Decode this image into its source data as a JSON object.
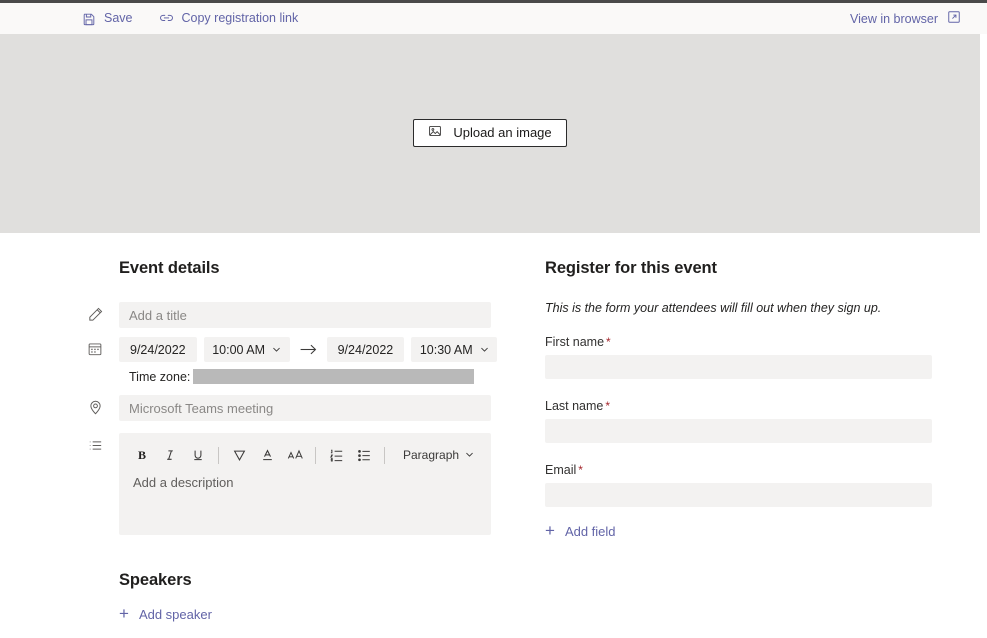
{
  "commandbar": {
    "save_label": "Save",
    "save_icon": "save-floppy-icon",
    "copy_link_label": "Copy registration link",
    "copy_link_icon": "link-icon",
    "view_in_browser_label": "View in browser",
    "view_in_browser_icon": "open-in-new-window-icon"
  },
  "hero": {
    "upload_label": "Upload an image",
    "upload_icon": "image-icon",
    "background_color": "#e0dfdd"
  },
  "event_details": {
    "heading": "Event details",
    "title_placeholder": "Add a title",
    "title_value": "",
    "title_icon": "pencil-icon",
    "schedule_icon": "calendar-icon",
    "start_date": "9/24/2022",
    "start_time": "10:00 AM",
    "arrow": "→",
    "end_date": "9/24/2022",
    "end_time": "10:30 AM",
    "timezone_label": "Time zone:",
    "timezone_value": "",
    "location_icon": "location-pin-icon",
    "location_placeholder": "Microsoft Teams meeting",
    "location_value": "",
    "description_icon": "list-icon",
    "description_placeholder": "Add a description",
    "editor_toolbar": [
      {
        "name": "bold-icon",
        "label": "B"
      },
      {
        "name": "italic-icon",
        "label": "I"
      },
      {
        "name": "underline-icon",
        "label": "U"
      },
      {
        "name": "highlight-icon",
        "label": ""
      },
      {
        "name": "font-color-icon",
        "label": ""
      },
      {
        "name": "font-size-icon",
        "label": ""
      },
      {
        "name": "numbered-list-icon",
        "label": ""
      },
      {
        "name": "bulleted-list-icon",
        "label": ""
      }
    ],
    "paragraph_label": "Paragraph",
    "paragraph_chevron": "chevron-down-icon"
  },
  "speakers": {
    "heading": "Speakers",
    "add_speaker_label": "Add speaker",
    "add_icon": "plus-icon"
  },
  "registration": {
    "heading": "Register for this event",
    "hint": "This is the form your attendees will fill out when they sign up.",
    "fields": [
      {
        "label": "First name",
        "required_marker": "*",
        "value": "",
        "placeholder": ""
      },
      {
        "label": "Last name",
        "required_marker": "*",
        "value": "",
        "placeholder": ""
      },
      {
        "label": "Email",
        "required_marker": "*",
        "value": "",
        "placeholder": ""
      }
    ],
    "add_field_label": "Add field",
    "add_icon": "plus-icon"
  },
  "colors": {
    "accent": "#6264a7",
    "required": "#a4262c",
    "field_bg": "#f3f2f1",
    "banner": "#e0dfdd",
    "commandbar_bg": "#faf9f8"
  }
}
